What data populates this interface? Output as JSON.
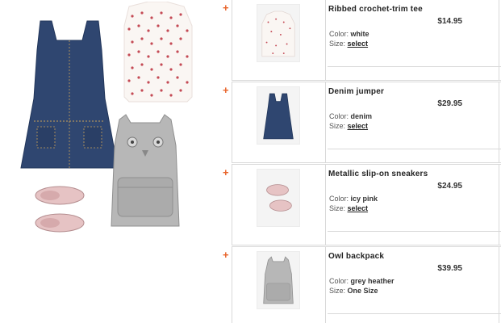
{
  "add_icon": "plus-icon",
  "accent_color": "#e8642a",
  "products": [
    {
      "name": "Ribbed crochet-trim tee",
      "price": "$14.95",
      "color_label": "Color:",
      "color_value": "white",
      "size_label": "Size:",
      "size_value": "select",
      "size_is_link": true,
      "thumb_icon": "polka-dot-tee-image"
    },
    {
      "name": "Denim jumper",
      "price": "$29.95",
      "color_label": "Color:",
      "color_value": "denim",
      "size_label": "Size:",
      "size_value": "select",
      "size_is_link": true,
      "thumb_icon": "denim-jumper-image"
    },
    {
      "name": "Metallic slip-on sneakers",
      "price": "$24.95",
      "color_label": "Color:",
      "color_value": "icy pink",
      "size_label": "Size:",
      "size_value": "select",
      "size_is_link": true,
      "thumb_icon": "pink-sneakers-image"
    },
    {
      "name": "Owl backpack",
      "price": "$39.95",
      "color_label": "Color:",
      "color_value": "grey heather",
      "size_label": "Size:",
      "size_value": "One Size",
      "size_is_link": false,
      "thumb_icon": "owl-backpack-image"
    }
  ]
}
